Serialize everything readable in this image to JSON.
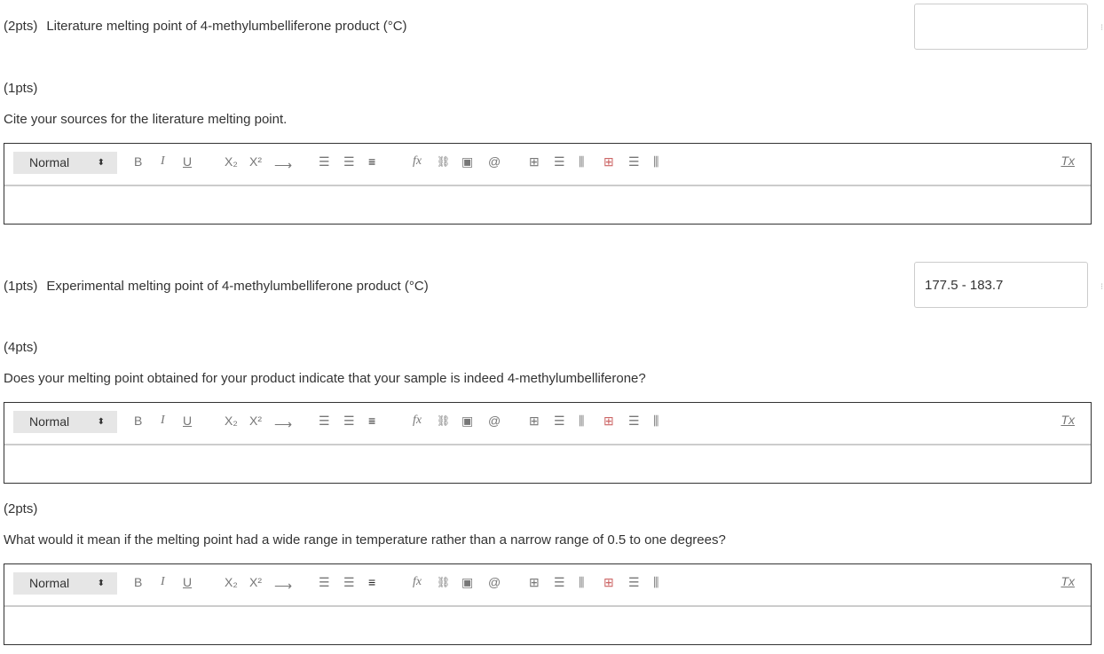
{
  "questions": [
    {
      "points": "(2pts)",
      "text": "Literature melting point of 4-methylumbelliferone product (°C)",
      "answer": ""
    },
    {
      "points": "(1pts)",
      "text": "Cite your sources for the literature melting point."
    },
    {
      "points": "(1pts)",
      "text": "Experimental melting point of 4-methylumbelliferone product (°C)",
      "answer": "177.5 - 183.7"
    },
    {
      "points": "(4pts)",
      "text": "Does your melting point obtained for your product indicate that your sample is indeed 4-methylumbelliferone?"
    },
    {
      "points": "(2pts)",
      "text": "What would it mean if the melting point had a wide range in temperature rather than a narrow range of 0.5 to one degrees?"
    }
  ],
  "toolbar": {
    "format": "Normal",
    "bold": "B",
    "italic": "I",
    "underline": "U",
    "subscript": "X₂",
    "superscript": "X²",
    "arrow": "⟶",
    "ordered_list": "☰",
    "bullet_list": "☰",
    "align": "≡",
    "formula": "fx",
    "link": "🔗",
    "image": "▣",
    "attach": "@",
    "table": "⊞",
    "clear": "Tx"
  }
}
